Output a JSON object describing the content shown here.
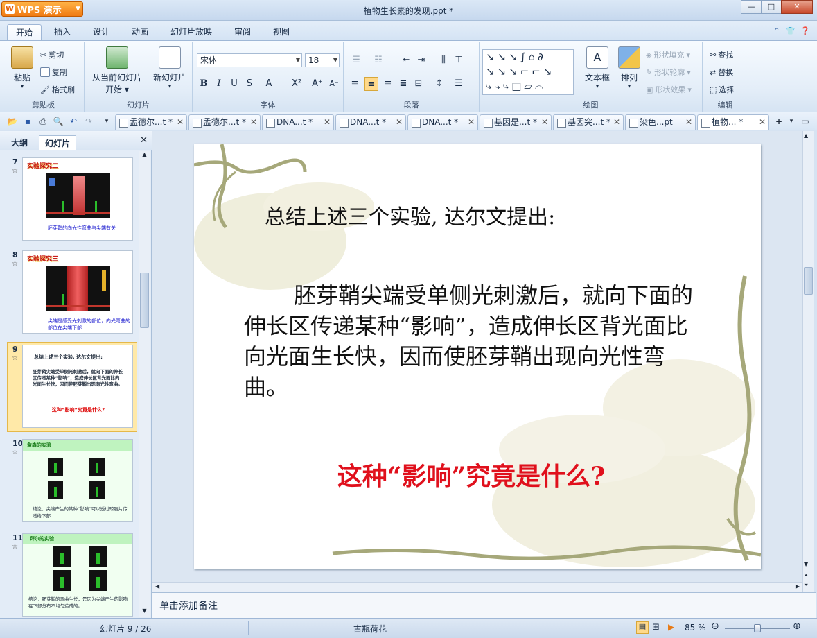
{
  "app": {
    "name": "WPS 演示",
    "doc_title": "植物生长素的发现.ppt *"
  },
  "ribbon_tabs": [
    "开始",
    "插入",
    "设计",
    "动画",
    "幻灯片放映",
    "审阅",
    "视图"
  ],
  "clipboard": {
    "paste": "粘贴",
    "cut": "剪切",
    "copy": "复制",
    "format_painter": "格式刷",
    "label": "剪贴板"
  },
  "slides_group": {
    "from_current": "从当前幻灯片",
    "start": "开始",
    "new_slide": "新幻灯片",
    "label": "幻灯片"
  },
  "font": {
    "name": "宋体",
    "size": "18",
    "label": "字体"
  },
  "paragraph": {
    "label": "段落"
  },
  "drawing": {
    "textbox": "文本框",
    "arrange": "排列",
    "shape_fill": "形状填充",
    "shape_outline": "形状轮廓",
    "shape_effect": "形状效果",
    "label": "绘图"
  },
  "editing": {
    "find": "查找",
    "replace": "替换",
    "select": "选择",
    "label": "编辑"
  },
  "doc_tabs": [
    "孟德尔...t *",
    "孟德尔...t *",
    "DNA...t *",
    "DNA...t *",
    "DNA...t *",
    "基因是...t *",
    "基因突...t *",
    "染色...pt",
    "植物... *"
  ],
  "left_panel": {
    "tab_outline": "大纲",
    "tab_slides": "幻灯片"
  },
  "thumbnails": [
    {
      "num": "7",
      "title": "实验探究二",
      "caption": "胚芽鞘的向光性弯曲与尖端有关"
    },
    {
      "num": "8",
      "title": "实验探究三",
      "caption": "尖端是感受光刺激的部位，向光弯曲的部位在尖端下部"
    },
    {
      "num": "9",
      "title": "总结上述三个实验, 达尔文提出:",
      "caption": "这种“影响”究竟是什么?"
    },
    {
      "num": "10",
      "title": "詹森的实验",
      "caption": "结论：尖端产生的某种“影响”可以透过琼脂片传递给下部"
    },
    {
      "num": "11",
      "title": "拜尔的实验",
      "caption": "结论：胚芽鞘的弯曲生长，是因为尖端产生的影响在下部分布不均匀造成的。"
    }
  ],
  "slide": {
    "heading": "总结上述三个实验, 达尔文提出:",
    "body": "胚芽鞘尖端受单侧光刺激后，就向下面的伸长区传递某种“影响”，造成伸长区背光面比向光面生长快，因而使胚芽鞘出现向光性弯曲。",
    "question": "这种“影响”究竟是什么?"
  },
  "notes_placeholder": "单击添加备注",
  "status": {
    "slide_info": "幻灯片 9 / 26",
    "theme": "古瓶荷花",
    "zoom": "85 %",
    "zoom_fraction": 0.5
  },
  "colors": {
    "accent": "#e87a14",
    "question_red": "#e0101c",
    "vine": "#a6a87a"
  }
}
